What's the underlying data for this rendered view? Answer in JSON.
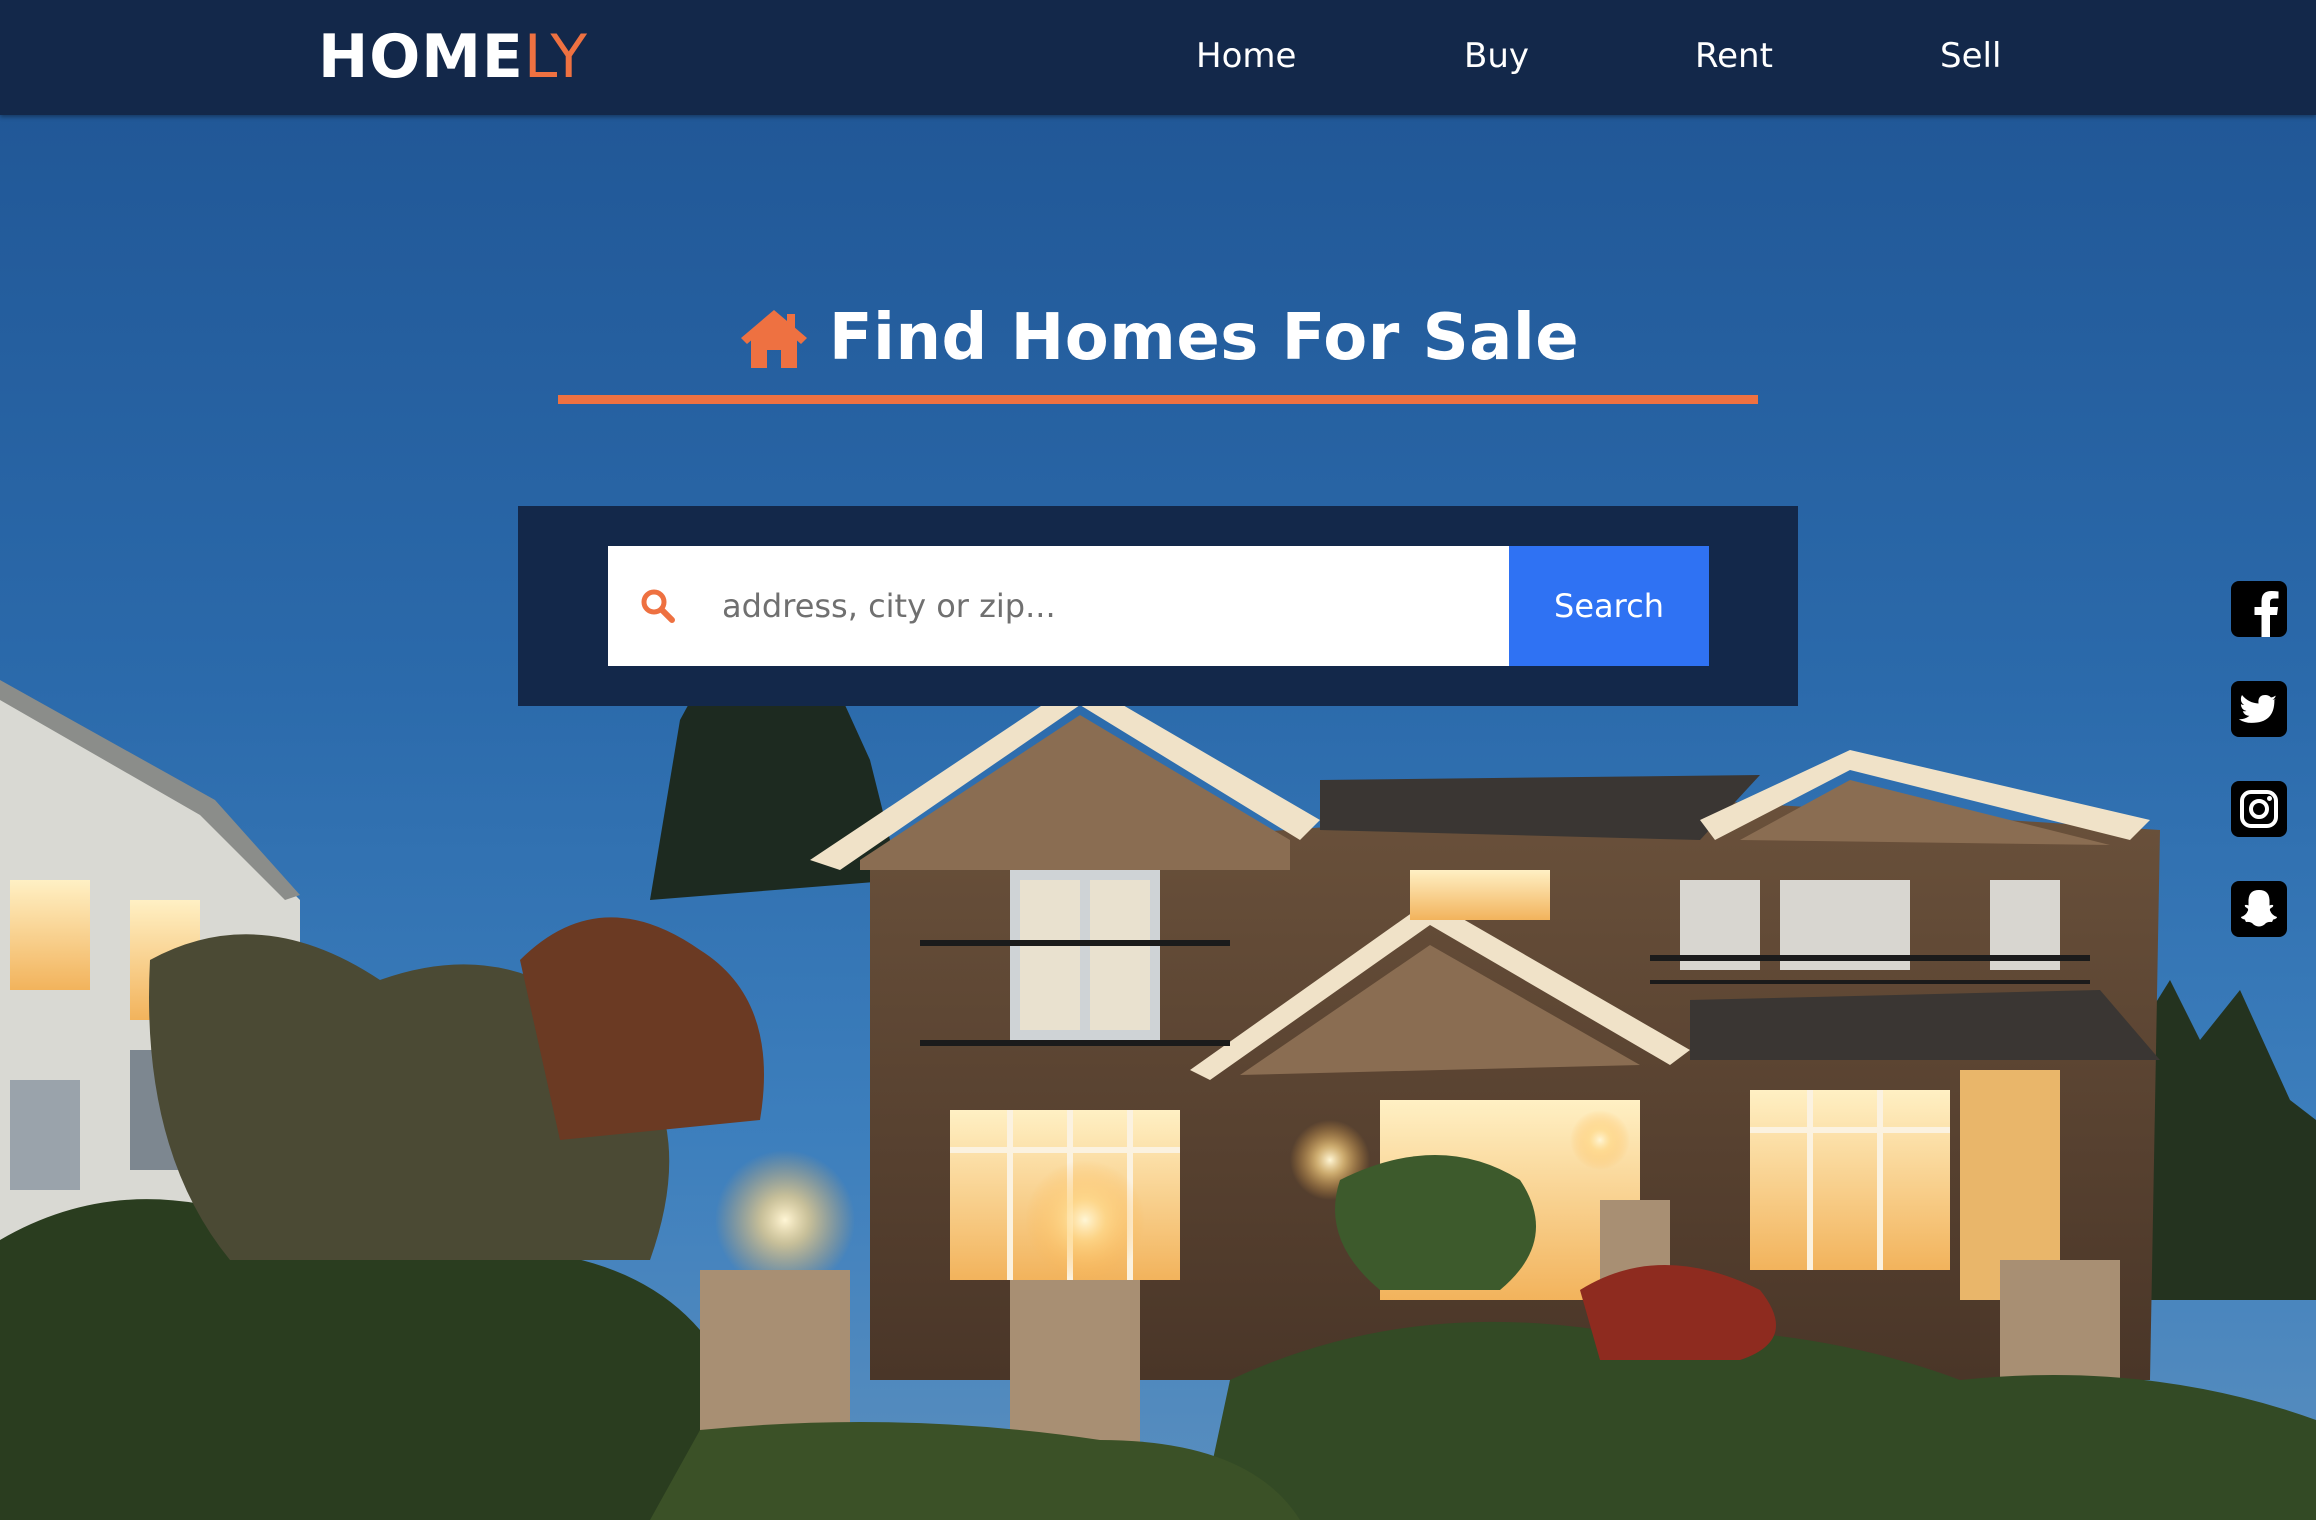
{
  "header": {
    "logo_main": "HOME",
    "logo_accent": "LY",
    "nav": [
      {
        "label": "Home"
      },
      {
        "label": "Buy"
      },
      {
        "label": "Rent"
      },
      {
        "label": "Sell"
      }
    ]
  },
  "hero": {
    "title": "Find Homes For Sale",
    "title_icon": "house-icon"
  },
  "search": {
    "placeholder": "address, city or zip...",
    "value": "",
    "button_label": "Search",
    "icon": "search-icon"
  },
  "social": [
    {
      "icon": "facebook-icon"
    },
    {
      "icon": "twitter-icon"
    },
    {
      "icon": "instagram-icon"
    },
    {
      "icon": "snapchat-icon"
    }
  ],
  "colors": {
    "navbar": "#13284a",
    "accent": "#ee7141",
    "search_button": "#2f72f3",
    "search_panel": "#13284a"
  }
}
